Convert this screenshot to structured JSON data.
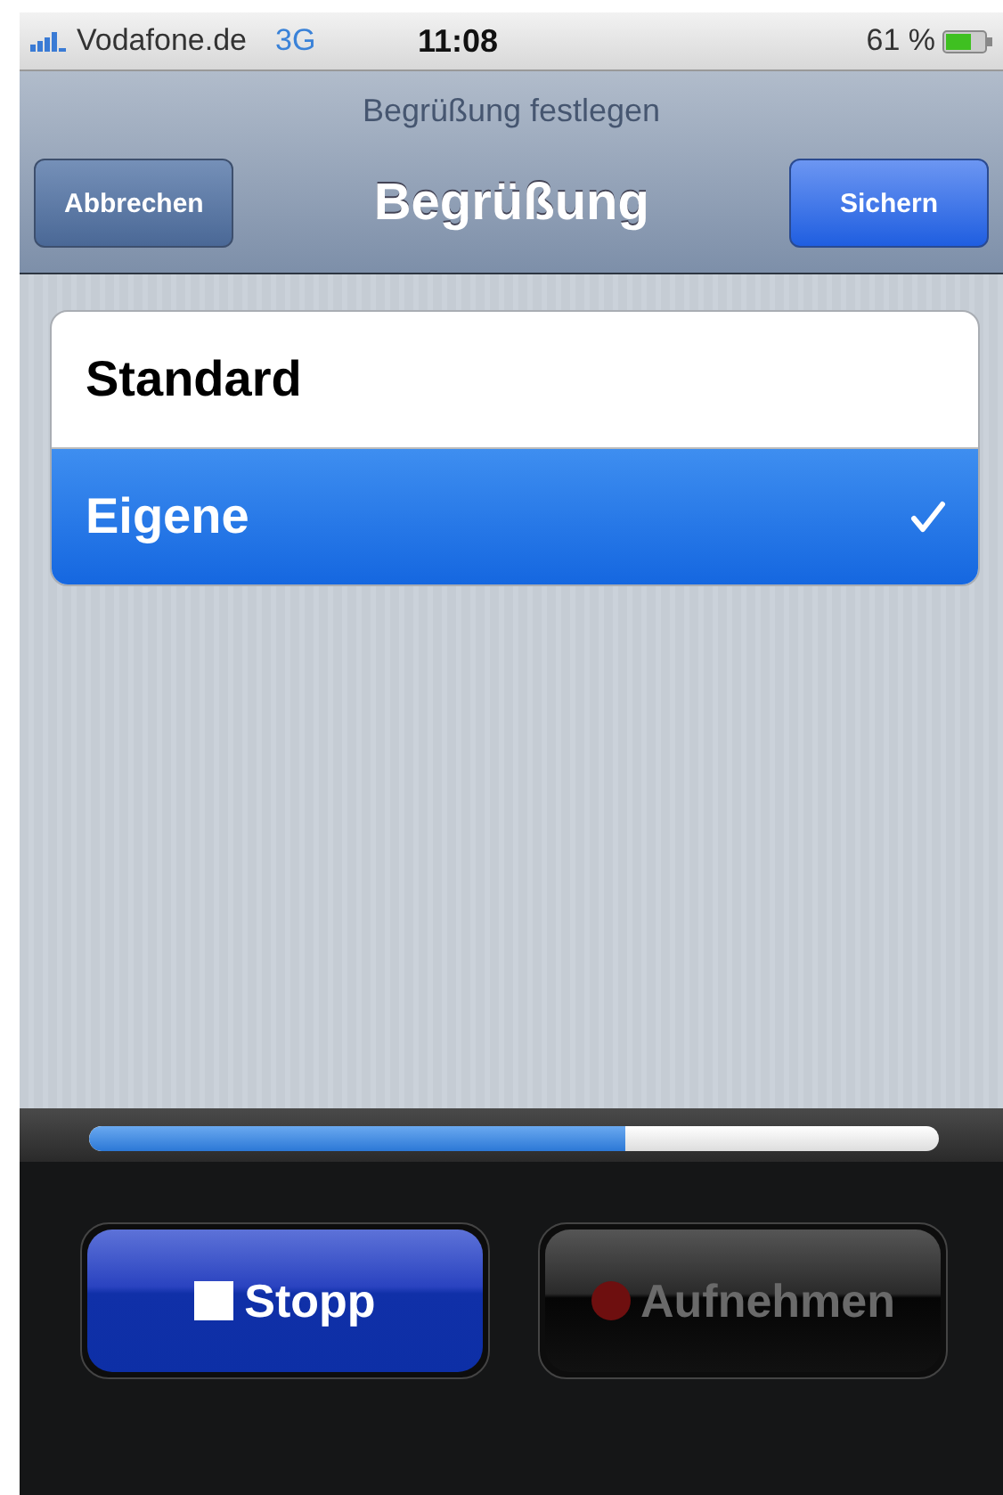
{
  "status_bar": {
    "carrier": "Vodafone.de",
    "network": "3G",
    "time": "11:08",
    "battery": "61 %"
  },
  "navigation": {
    "prompt": "Begrüßung festlegen",
    "title": "Begrüßung",
    "left_button": "Abbrechen",
    "right_button": "Sichern"
  },
  "options": [
    {
      "label": "Standard",
      "selected": false
    },
    {
      "label": "Eigene",
      "selected": true
    }
  ],
  "recorder": {
    "level": 0.63,
    "buttons": [
      {
        "label": "Stopp",
        "kind": "stop",
        "disabled": false
      },
      {
        "label": "Aufnehmen",
        "kind": "record",
        "disabled": true
      }
    ]
  }
}
